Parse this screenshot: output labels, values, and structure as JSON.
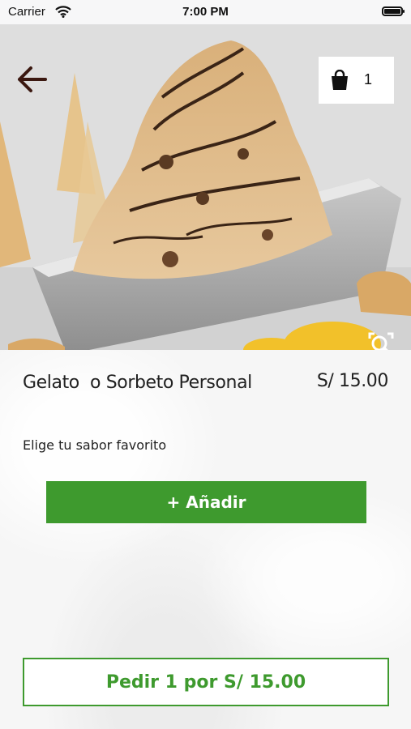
{
  "status_bar": {
    "carrier": "Carrier",
    "time": "7:00 PM",
    "icons": [
      "wifi-icon",
      "battery-icon"
    ]
  },
  "header": {
    "back_icon": "arrow-left-icon",
    "cart": {
      "icon": "shopping-bag-icon",
      "count": "1"
    },
    "zoom_icon": "zoom-image-icon"
  },
  "product": {
    "name": "Gelato  o Sorbeto Personal",
    "price": "S/ 15.00",
    "flavor_prompt": "Elige tu sabor favorito"
  },
  "actions": {
    "add_label": "+ Añadir",
    "order_label": "Pedir 1 por S/ 15.00"
  },
  "colors": {
    "accent": "#3e9a2e",
    "text": "#222222"
  }
}
